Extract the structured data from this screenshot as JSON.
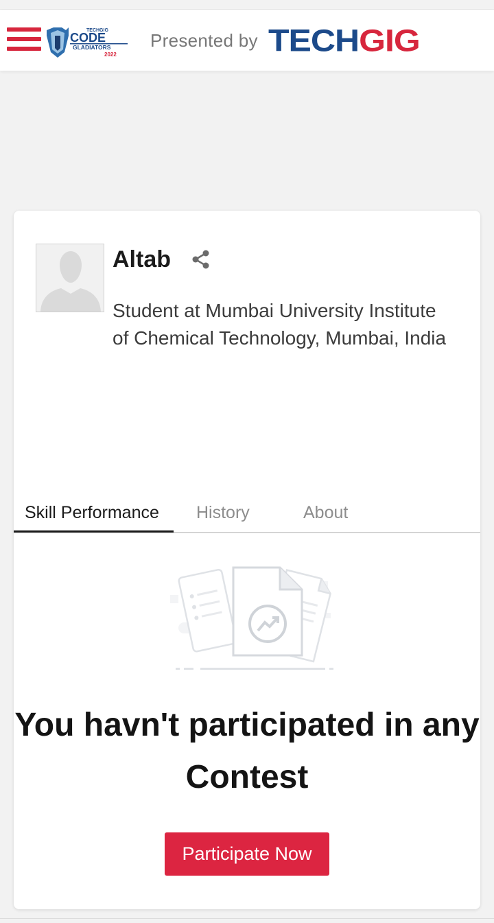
{
  "header": {
    "menu_icon": "hamburger-menu-icon",
    "logo_small_text": "TECHGIG",
    "logo_main_text": "CODE",
    "logo_sub_text": "GLADIATORS",
    "logo_year": "2022",
    "presented_by": "Presented by",
    "brand_part1": "TECH",
    "brand_part2": "GIG",
    "accent_color": "#d7263d",
    "brand_blue": "#1c4a8a"
  },
  "profile": {
    "name": "Altab",
    "share_icon": "share-icon",
    "bio": "Student at Mumbai University Institute of Chemical Technology, Mumbai, India"
  },
  "tabs": [
    {
      "label": "Skill Performance",
      "active": true
    },
    {
      "label": "History",
      "active": false
    },
    {
      "label": "About",
      "active": false
    }
  ],
  "empty_state": {
    "illustration": "documents-chart-icon",
    "message": "You havn't participated in any Contest",
    "message_line1": "You havn't participated in any",
    "message_line2": "Contest",
    "cta_label": "Participate Now"
  }
}
